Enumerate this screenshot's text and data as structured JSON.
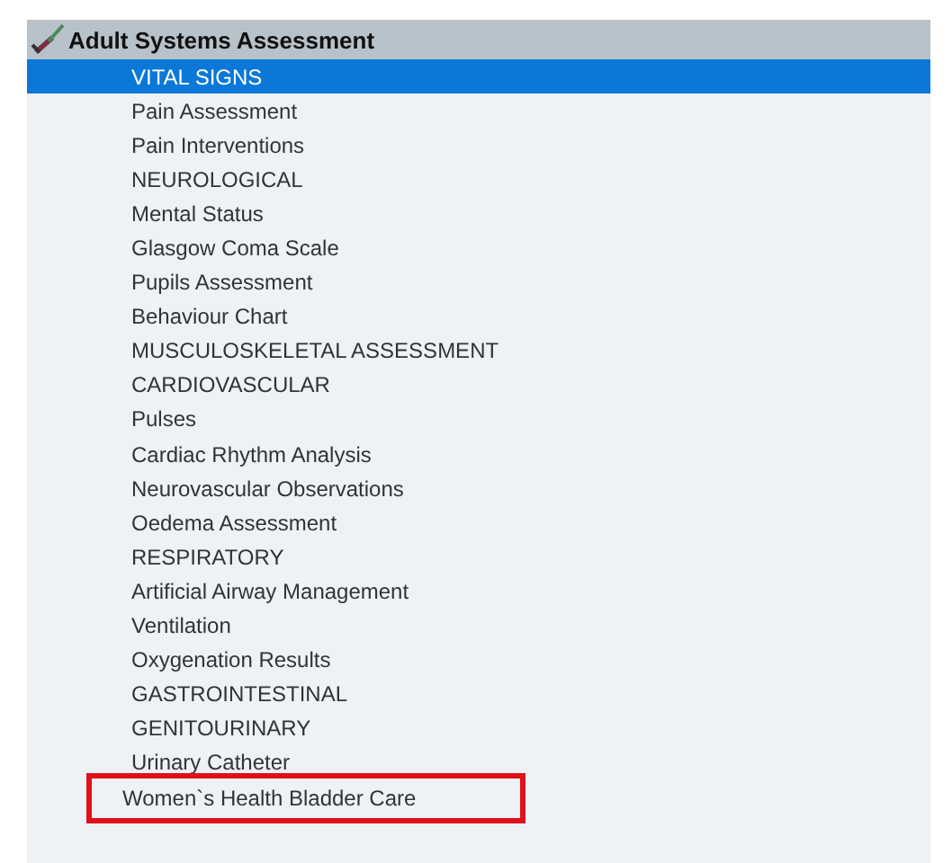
{
  "header": {
    "title": "Adult Systems Assessment"
  },
  "items": [
    {
      "label": "VITAL SIGNS",
      "selected": true,
      "highlighted": false
    },
    {
      "label": "Pain Assessment",
      "selected": false,
      "highlighted": false
    },
    {
      "label": "Pain Interventions",
      "selected": false,
      "highlighted": false
    },
    {
      "label": "NEUROLOGICAL",
      "selected": false,
      "highlighted": false
    },
    {
      "label": "Mental Status",
      "selected": false,
      "highlighted": false
    },
    {
      "label": "Glasgow Coma Scale",
      "selected": false,
      "highlighted": false
    },
    {
      "label": "Pupils Assessment",
      "selected": false,
      "highlighted": false
    },
    {
      "label": "Behaviour Chart",
      "selected": false,
      "highlighted": false
    },
    {
      "label": "MUSCULOSKELETAL ASSESSMENT",
      "selected": false,
      "highlighted": false
    },
    {
      "label": "CARDIOVASCULAR",
      "selected": false,
      "highlighted": false
    },
    {
      "label": "Pulses",
      "selected": false,
      "highlighted": false
    },
    {
      "label": "Cardiac Rhythm Analysis",
      "selected": false,
      "highlighted": false
    },
    {
      "label": "Neurovascular Observations",
      "selected": false,
      "highlighted": false
    },
    {
      "label": "Oedema Assessment",
      "selected": false,
      "highlighted": false
    },
    {
      "label": "RESPIRATORY",
      "selected": false,
      "highlighted": false
    },
    {
      "label": "Artificial Airway Management",
      "selected": false,
      "highlighted": false
    },
    {
      "label": "Ventilation",
      "selected": false,
      "highlighted": false
    },
    {
      "label": "Oxygenation Results",
      "selected": false,
      "highlighted": false
    },
    {
      "label": "GASTROINTESTINAL",
      "selected": false,
      "highlighted": false
    },
    {
      "label": "GENITOURINARY",
      "selected": false,
      "highlighted": false
    },
    {
      "label": "Urinary Catheter",
      "selected": false,
      "highlighted": false
    },
    {
      "label": "Women`s Health Bladder Care",
      "selected": false,
      "highlighted": true
    }
  ]
}
